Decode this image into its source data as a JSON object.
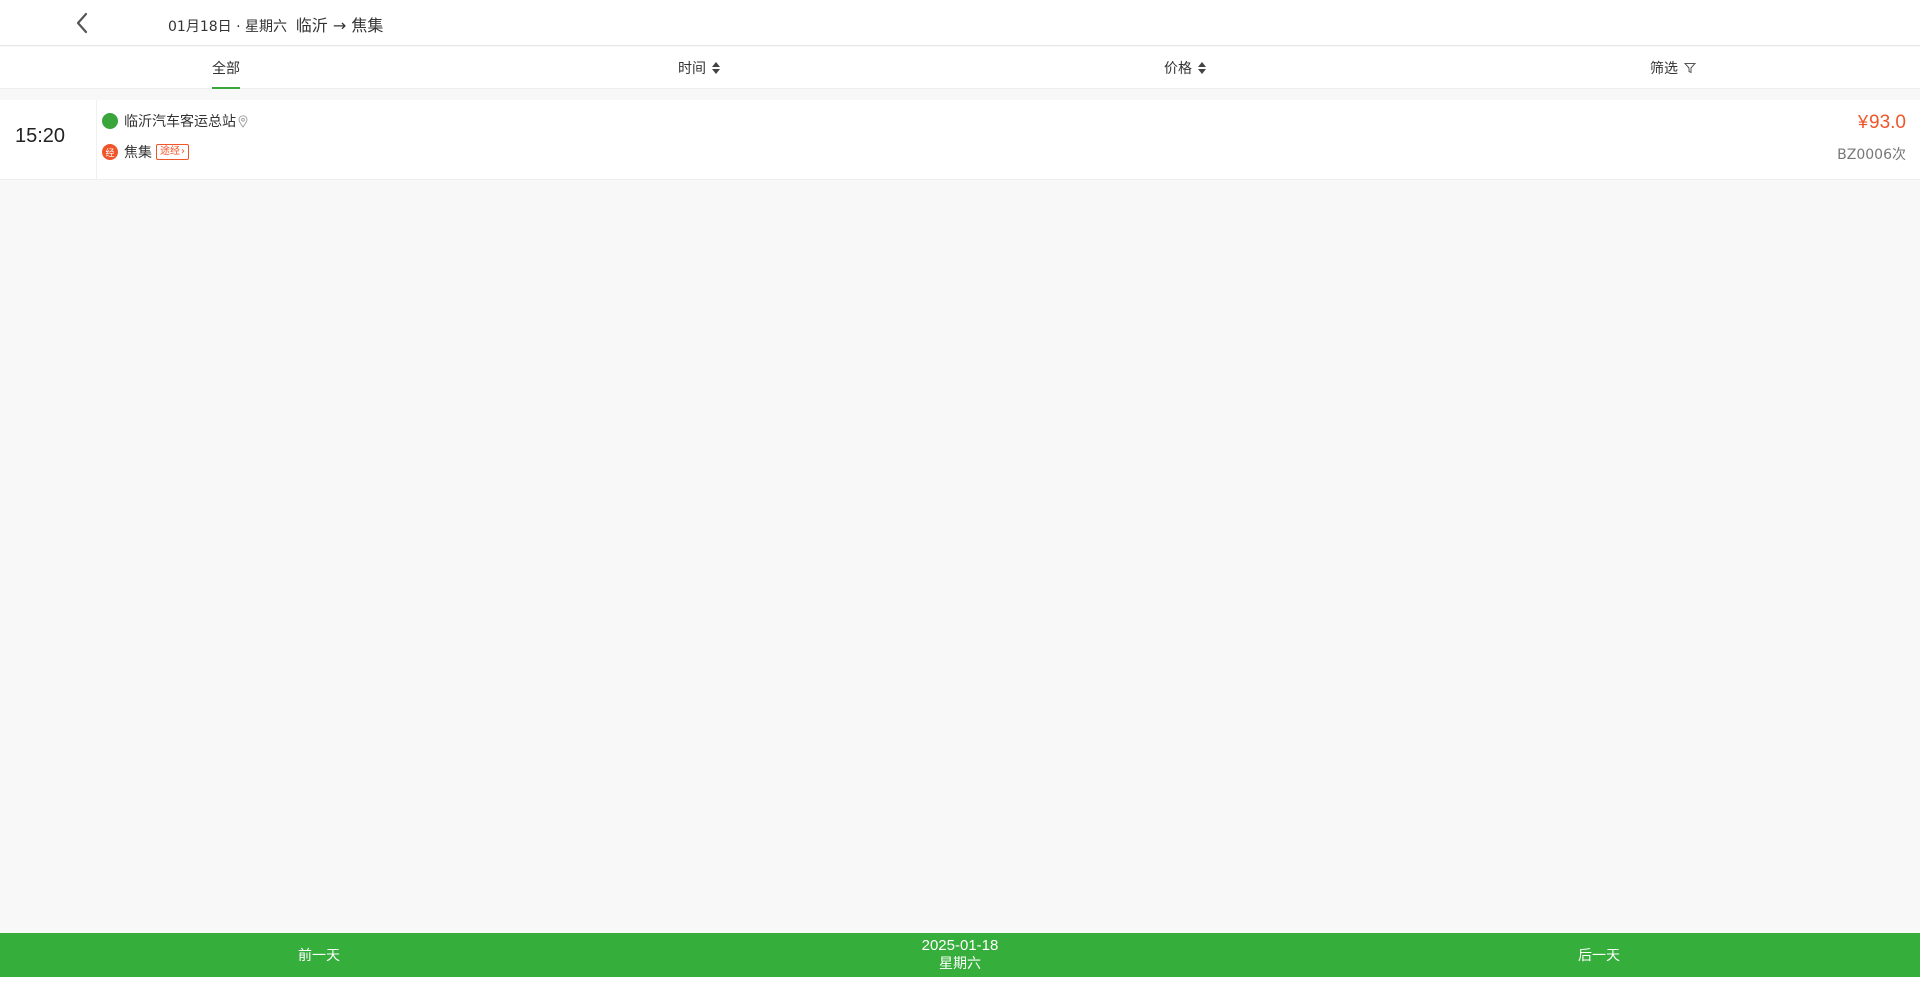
{
  "header": {
    "back_icon": "chevron-left-icon",
    "date_text": "01月18日 · 星期六",
    "route_text": "临沂 → 焦集"
  },
  "tabs": [
    {
      "label": "全部",
      "active": true
    },
    {
      "label": "时间",
      "icon": "sort-icon"
    },
    {
      "label": "价格",
      "icon": "sort-icon"
    },
    {
      "label": "筛选",
      "icon": "filter-icon"
    }
  ],
  "trips": [
    {
      "time": "15:20",
      "depart_station": "临沂汽车客运总站",
      "arrive_station": "焦集",
      "pass_badge": "经",
      "via_tag": "途经",
      "price_symbol": "¥",
      "price": "93.0",
      "bus_no": "BZ0006次"
    }
  ],
  "bottom_bar": {
    "prev_label": "前一天",
    "date": "2025-01-18",
    "weekday": "星期六",
    "next_label": "后一天"
  },
  "colors": {
    "accent_green": "#36ae3b",
    "price_red": "#f0552a"
  }
}
